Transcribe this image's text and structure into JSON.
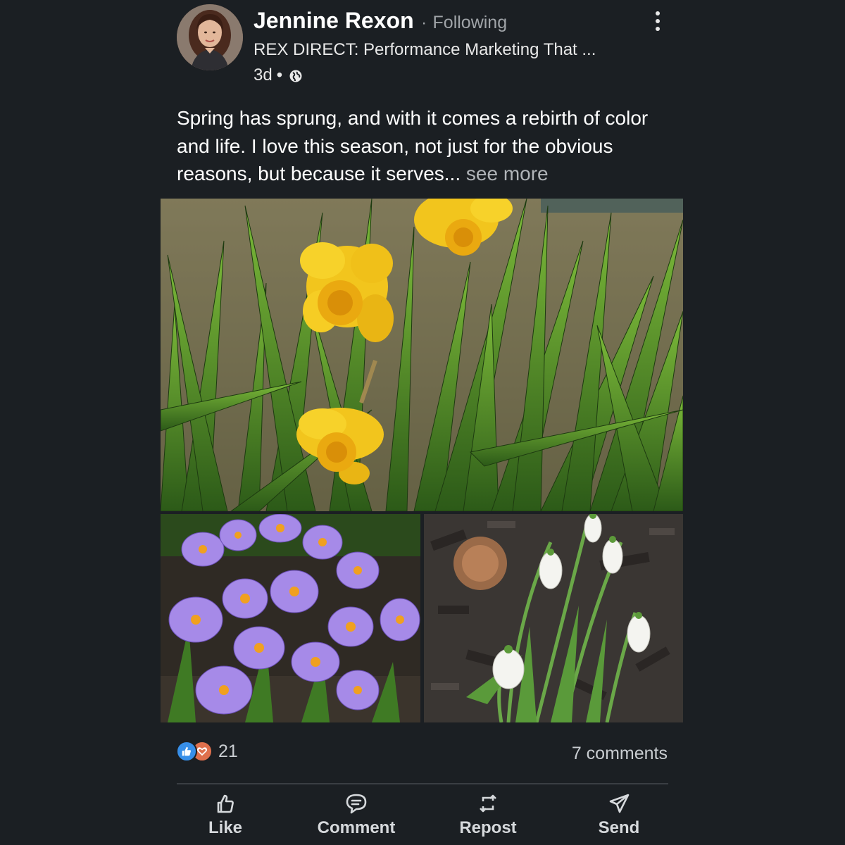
{
  "post": {
    "author": {
      "name": "Jennine Rexon",
      "separator": "·",
      "follow_status": "Following",
      "headline": "REX DIRECT: Performance Marketing That ...",
      "time": "3d",
      "meta_separator": "•",
      "visibility_icon": "globe-icon"
    },
    "more_icon": "more-vertical-icon",
    "text": "Spring has sprung, and with it comes a rebirth of color and life. I love this season, not just for the obvious reasons, but because it serves...",
    "see_more": " see more",
    "images": [
      {
        "subject": "daffodils",
        "icon": "photo"
      },
      {
        "subject": "crocuses",
        "icon": "photo"
      },
      {
        "subject": "snowdrops",
        "icon": "photo"
      }
    ],
    "social": {
      "reaction_icons": [
        "like-reaction-icon",
        "love-reaction-icon"
      ],
      "reaction_count": "21",
      "comments": "7 comments"
    },
    "actions": [
      {
        "label": "Like",
        "icon": "thumbs-up-icon"
      },
      {
        "label": "Comment",
        "icon": "comment-icon"
      },
      {
        "label": "Repost",
        "icon": "repost-icon"
      },
      {
        "label": "Send",
        "icon": "send-icon"
      }
    ],
    "colors": {
      "background": "#1b1f23",
      "like_blue": "#378fe9",
      "love_orange": "#df704d",
      "muted_text": "#a0a4a8"
    }
  }
}
